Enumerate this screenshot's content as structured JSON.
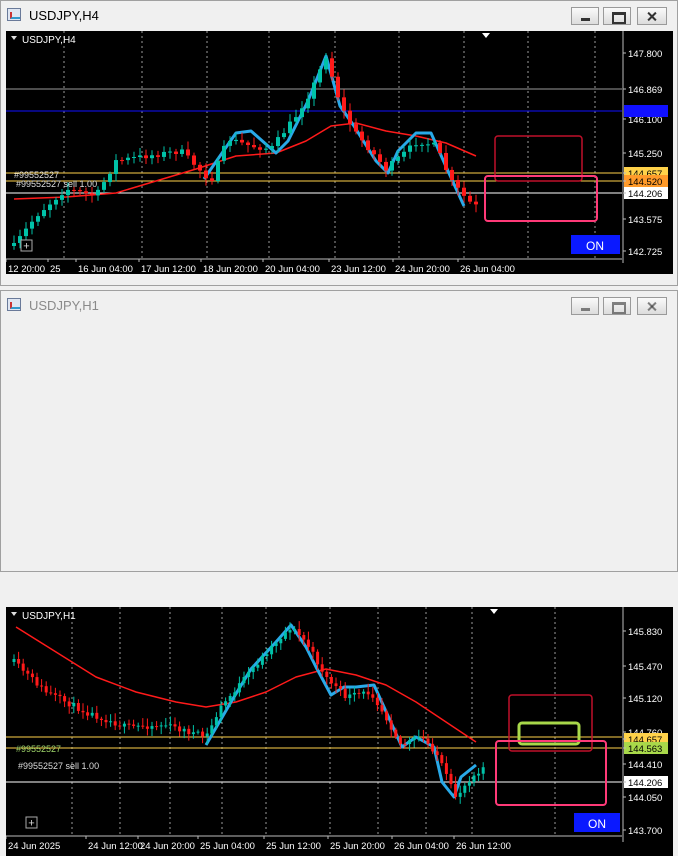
{
  "windows": [
    {
      "title": "USDJPY,H4",
      "chart_label": "USDJPY,H4",
      "timeframe": "H4",
      "price_axis": [
        "147.800",
        "146.869",
        "146.100",
        "145.250",
        "144.657",
        "144.520",
        "144.206",
        "143.575",
        "142.725"
      ],
      "time_axis": [
        "12 20:00",
        "25",
        "16 Jun 04:00",
        "17 Jun 12:00",
        "18 Jun 20:00",
        "20 Jun 04:00",
        "23 Jun 12:00",
        "24 Jun 20:00",
        "26 Jun 04:00"
      ],
      "order_labels": [
        "#99552527",
        "#99552527 sell 1.00"
      ],
      "hidden_blue_tag": "146.2__",
      "on_label": "ON"
    },
    {
      "title": "USDJPY,H1",
      "chart_label": "USDJPY,H1",
      "timeframe": "H1",
      "price_axis": [
        "145.830",
        "145.470",
        "145.120",
        "144.760",
        "144.657",
        "144.563",
        "144.410",
        "144.206",
        "144.050",
        "143.700"
      ],
      "time_axis": [
        "24 Jun 2025",
        "24 Jun 12:00",
        "24 Jun 20:00",
        "25 Jun 04:00",
        "25 Jun 12:00",
        "25 Jun 20:00",
        "26 Jun 04:00",
        "26 Jun 12:00"
      ],
      "order_labels": [
        "#99552527",
        "#99552527 sell 1.00"
      ],
      "on_label": "ON"
    }
  ],
  "colors": {
    "background": "#000000",
    "bull_candle": "#00c2a8",
    "bear_candle": "#ff1a1a",
    "moving_average": "#ff1a1a",
    "zigzag": "#29a9e8",
    "ask_line": "#1010ff",
    "gold_line": "#ffd24a",
    "white_line": "#ffffff",
    "gray_line": "#9a9a9a",
    "box_dark_red": "#c0102a",
    "box_pink": "#ff3a78",
    "box_green": "#a8d84a",
    "on_badge": "#0a19ff"
  }
}
